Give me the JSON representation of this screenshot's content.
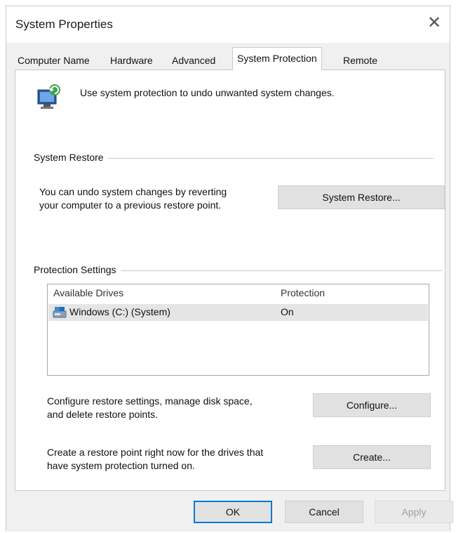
{
  "window": {
    "title": "System Properties",
    "close_symbol": "✕"
  },
  "tabs": [
    {
      "label": "Computer Name",
      "active": false
    },
    {
      "label": "Hardware",
      "active": false
    },
    {
      "label": "Advanced",
      "active": false
    },
    {
      "label": "System Protection",
      "active": true
    },
    {
      "label": "Remote",
      "active": false
    }
  ],
  "intro": {
    "icon": "system-protection-icon",
    "text": "Use system protection to undo unwanted system changes."
  },
  "system_restore": {
    "group_label": "System Restore",
    "description_line1": "You can undo system changes by reverting",
    "description_line2": "your computer to a previous restore point.",
    "button_label": "System Restore..."
  },
  "protection_settings": {
    "group_label": "Protection Settings",
    "columns": [
      "Available Drives",
      "Protection"
    ],
    "drives": [
      {
        "name": "Windows (C:) (System)",
        "protection": "On",
        "icon": "drive-icon"
      }
    ],
    "configure_text_line1": "Configure restore settings, manage disk space,",
    "configure_text_line2": "and delete restore points.",
    "configure_button": "Configure...",
    "create_text_line1": "Create a restore point right now for the drives that",
    "create_text_line2": "have system protection turned on.",
    "create_button": "Create..."
  },
  "footer": {
    "ok": "OK",
    "cancel": "Cancel",
    "apply": "Apply"
  }
}
